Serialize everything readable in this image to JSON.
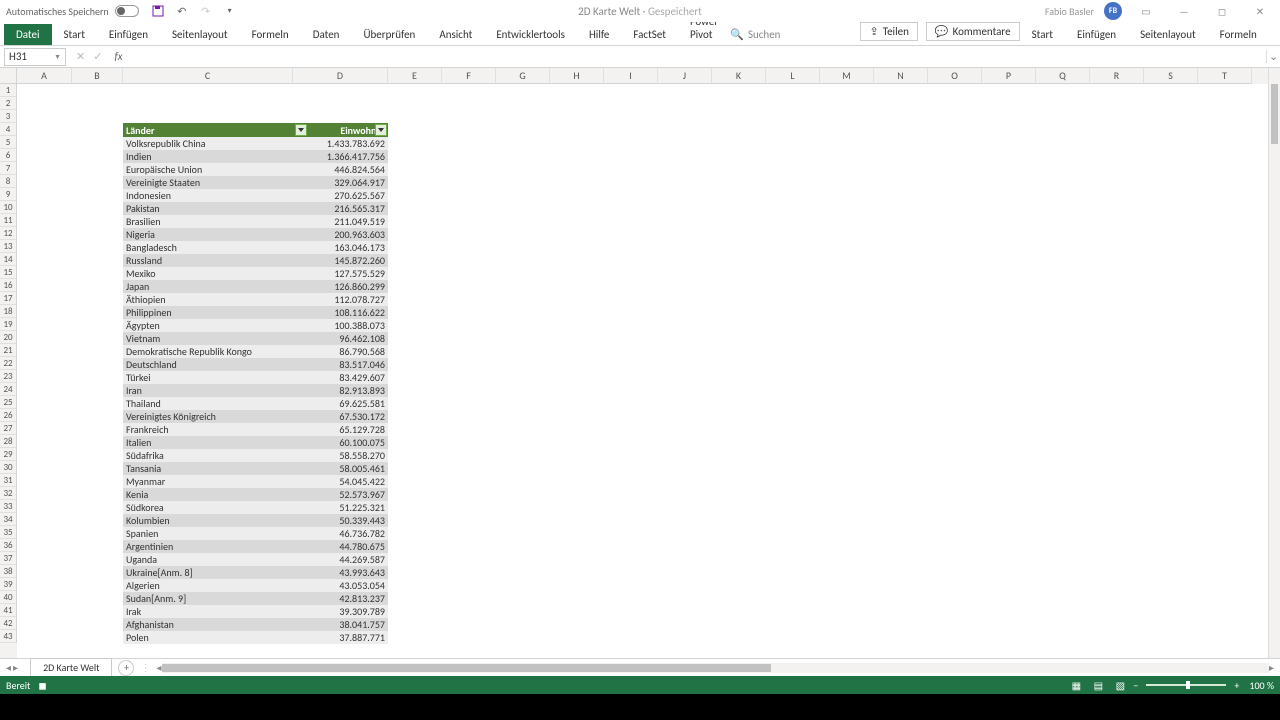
{
  "title": {
    "autosave": "Automatisches Speichern",
    "doc": "2D Karte Welt",
    "saved": "Gespeichert",
    "user": "Fabio Basler",
    "initials": "FB"
  },
  "ribbon": {
    "file": "Datei",
    "tabs": [
      "Start",
      "Einfügen",
      "Seitenlayout",
      "Formeln",
      "Daten",
      "Überprüfen",
      "Ansicht",
      "Entwicklertools",
      "Hilfe",
      "FactSet",
      "Power Pivot"
    ],
    "search": "Suchen",
    "share": "Teilen",
    "comments": "Kommentare"
  },
  "formula": {
    "namebox": "H31",
    "fx": "fx"
  },
  "columns": [
    "A",
    "B",
    "C",
    "D",
    "E",
    "F",
    "G",
    "H",
    "I",
    "J",
    "K",
    "L",
    "M",
    "N",
    "O",
    "P",
    "Q",
    "R",
    "S",
    "T"
  ],
  "table": {
    "headers": {
      "country": "Länder",
      "pop": "Einwohner"
    },
    "rows": [
      {
        "c": "Volksrepublik China",
        "p": "1.433.783.692"
      },
      {
        "c": "Indien",
        "p": "1.366.417.756"
      },
      {
        "c": "Europäische Union",
        "p": "446.824.564"
      },
      {
        "c": "Vereinigte Staaten",
        "p": "329.064.917"
      },
      {
        "c": "Indonesien",
        "p": "270.625.567"
      },
      {
        "c": "Pakistan",
        "p": "216.565.317"
      },
      {
        "c": "Brasilien",
        "p": "211.049.519"
      },
      {
        "c": "Nigeria",
        "p": "200.963.603"
      },
      {
        "c": "Bangladesch",
        "p": "163.046.173"
      },
      {
        "c": "Russland",
        "p": "145.872.260"
      },
      {
        "c": "Mexiko",
        "p": "127.575.529"
      },
      {
        "c": "Japan",
        "p": "126.860.299"
      },
      {
        "c": "Äthiopien",
        "p": "112.078.727"
      },
      {
        "c": "Philippinen",
        "p": "108.116.622"
      },
      {
        "c": "Ägypten",
        "p": "100.388.073"
      },
      {
        "c": "Vietnam",
        "p": "96.462.108"
      },
      {
        "c": "Demokratische Republik Kongo",
        "p": "86.790.568"
      },
      {
        "c": "Deutschland",
        "p": "83.517.046"
      },
      {
        "c": "Türkei",
        "p": "83.429.607"
      },
      {
        "c": "Iran",
        "p": "82.913.893"
      },
      {
        "c": "Thailand",
        "p": "69.625.581"
      },
      {
        "c": "Vereinigtes Königreich",
        "p": "67.530.172"
      },
      {
        "c": "Frankreich",
        "p": "65.129.728"
      },
      {
        "c": "Italien",
        "p": "60.100.075"
      },
      {
        "c": "Südafrika",
        "p": "58.558.270"
      },
      {
        "c": "Tansania",
        "p": "58.005.461"
      },
      {
        "c": "Myanmar",
        "p": "54.045.422"
      },
      {
        "c": "Kenia",
        "p": "52.573.967"
      },
      {
        "c": "Südkorea",
        "p": "51.225.321"
      },
      {
        "c": "Kolumbien",
        "p": "50.339.443"
      },
      {
        "c": "Spanien",
        "p": "46.736.782"
      },
      {
        "c": "Argentinien",
        "p": "44.780.675"
      },
      {
        "c": "Uganda",
        "p": "44.269.587"
      },
      {
        "c": "Ukraine[Anm. 8]",
        "p": "43.993.643"
      },
      {
        "c": "Algerien",
        "p": "43.053.054"
      },
      {
        "c": "Sudan[Anm. 9]",
        "p": "42.813.237"
      },
      {
        "c": "Irak",
        "p": "39.309.789"
      },
      {
        "c": "Afghanistan",
        "p": "38.041.757"
      },
      {
        "c": "Polen",
        "p": "37.887.771"
      }
    ]
  },
  "sheet": {
    "name": "2D Karte Welt"
  },
  "status": {
    "ready": "Bereit",
    "zoom": "100 %"
  }
}
